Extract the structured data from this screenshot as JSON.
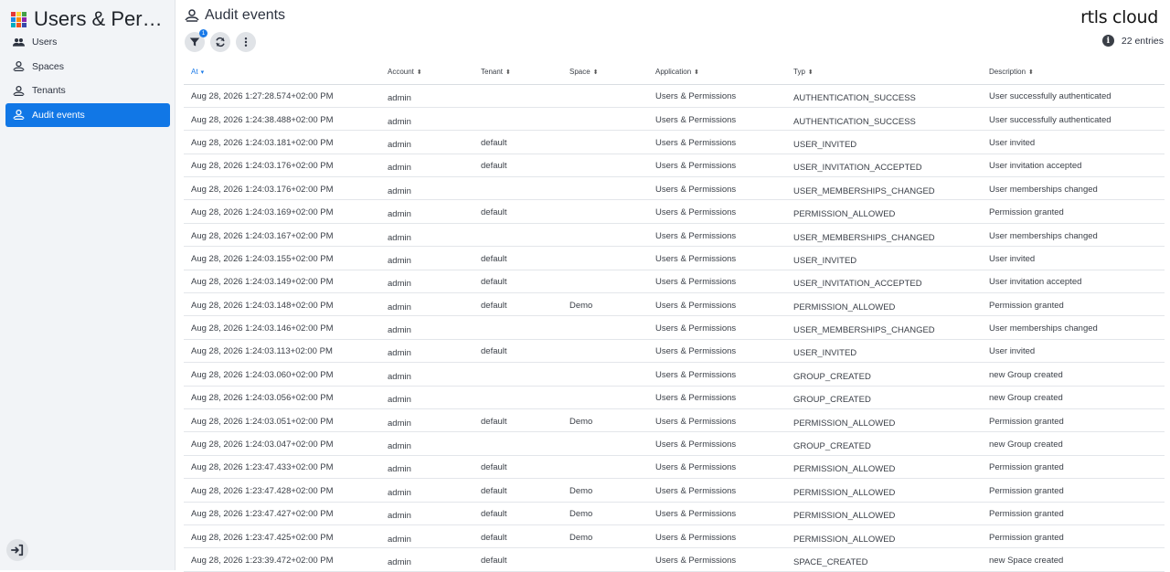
{
  "app": {
    "title": "Users & Permi…",
    "grid_colors": [
      "#e53935",
      "#fdd835",
      "#43a047",
      "#1e88e5",
      "#fb8c00",
      "#8e24aa",
      "#00acc1",
      "#f4511e",
      "#3949ab"
    ]
  },
  "nav": [
    {
      "label": "Users",
      "icon": "users-icon",
      "active": false
    },
    {
      "label": "Spaces",
      "icon": "spaces-icon",
      "active": false
    },
    {
      "label": "Tenants",
      "icon": "tenants-icon",
      "active": false
    },
    {
      "label": "Audit events",
      "icon": "audit-icon",
      "active": true
    }
  ],
  "page": {
    "title": "Audit events",
    "brand": "rtls cloud",
    "entries_label": "22 entries",
    "filter_badge": "1",
    "accent": "#1177e6"
  },
  "table": {
    "columns": [
      "At",
      "Account",
      "Tenant",
      "Space",
      "Application",
      "Typ",
      "Description"
    ],
    "rows": [
      [
        "Aug 28, 2026 1:27:28.574+02:00 PM",
        "admin",
        "",
        "",
        "Users & Permissions",
        "AUTHENTICATION_SUCCESS",
        "User successfully authenticated"
      ],
      [
        "Aug 28, 2026 1:24:38.488+02:00 PM",
        "admin",
        "",
        "",
        "Users & Permissions",
        "AUTHENTICATION_SUCCESS",
        "User successfully authenticated"
      ],
      [
        "Aug 28, 2026 1:24:03.181+02:00 PM",
        "admin",
        "default",
        "",
        "Users & Permissions",
        "USER_INVITED",
        "User invited"
      ],
      [
        "Aug 28, 2026 1:24:03.176+02:00 PM",
        "admin",
        "default",
        "",
        "Users & Permissions",
        "USER_INVITATION_ACCEPTED",
        "User invitation accepted"
      ],
      [
        "Aug 28, 2026 1:24:03.176+02:00 PM",
        "admin",
        "",
        "",
        "Users & Permissions",
        "USER_MEMBERSHIPS_CHANGED",
        "User memberships changed"
      ],
      [
        "Aug 28, 2026 1:24:03.169+02:00 PM",
        "admin",
        "default",
        "",
        "Users & Permissions",
        "PERMISSION_ALLOWED",
        "Permission granted"
      ],
      [
        "Aug 28, 2026 1:24:03.167+02:00 PM",
        "admin",
        "",
        "",
        "Users & Permissions",
        "USER_MEMBERSHIPS_CHANGED",
        "User memberships changed"
      ],
      [
        "Aug 28, 2026 1:24:03.155+02:00 PM",
        "admin",
        "default",
        "",
        "Users & Permissions",
        "USER_INVITED",
        "User invited"
      ],
      [
        "Aug 28, 2026 1:24:03.149+02:00 PM",
        "admin",
        "default",
        "",
        "Users & Permissions",
        "USER_INVITATION_ACCEPTED",
        "User invitation accepted"
      ],
      [
        "Aug 28, 2026 1:24:03.148+02:00 PM",
        "admin",
        "default",
        "Demo",
        "Users & Permissions",
        "PERMISSION_ALLOWED",
        "Permission granted"
      ],
      [
        "Aug 28, 2026 1:24:03.146+02:00 PM",
        "admin",
        "",
        "",
        "Users & Permissions",
        "USER_MEMBERSHIPS_CHANGED",
        "User memberships changed"
      ],
      [
        "Aug 28, 2026 1:24:03.113+02:00 PM",
        "admin",
        "default",
        "",
        "Users & Permissions",
        "USER_INVITED",
        "User invited"
      ],
      [
        "Aug 28, 2026 1:24:03.060+02:00 PM",
        "admin",
        "",
        "",
        "Users & Permissions",
        "GROUP_CREATED",
        "new Group created"
      ],
      [
        "Aug 28, 2026 1:24:03.056+02:00 PM",
        "admin",
        "",
        "",
        "Users & Permissions",
        "GROUP_CREATED",
        "new Group created"
      ],
      [
        "Aug 28, 2026 1:24:03.051+02:00 PM",
        "admin",
        "default",
        "Demo",
        "Users & Permissions",
        "PERMISSION_ALLOWED",
        "Permission granted"
      ],
      [
        "Aug 28, 2026 1:24:03.047+02:00 PM",
        "admin",
        "",
        "",
        "Users & Permissions",
        "GROUP_CREATED",
        "new Group created"
      ],
      [
        "Aug 28, 2026 1:23:47.433+02:00 PM",
        "admin",
        "default",
        "",
        "Users & Permissions",
        "PERMISSION_ALLOWED",
        "Permission granted"
      ],
      [
        "Aug 28, 2026 1:23:47.428+02:00 PM",
        "admin",
        "default",
        "Demo",
        "Users & Permissions",
        "PERMISSION_ALLOWED",
        "Permission granted"
      ],
      [
        "Aug 28, 2026 1:23:47.427+02:00 PM",
        "admin",
        "default",
        "Demo",
        "Users & Permissions",
        "PERMISSION_ALLOWED",
        "Permission granted"
      ],
      [
        "Aug 28, 2026 1:23:47.425+02:00 PM",
        "admin",
        "default",
        "Demo",
        "Users & Permissions",
        "PERMISSION_ALLOWED",
        "Permission granted"
      ],
      [
        "Aug 28, 2026 1:23:39.472+02:00 PM",
        "admin",
        "default",
        "",
        "Users & Permissions",
        "SPACE_CREATED",
        "new Space created"
      ]
    ]
  }
}
